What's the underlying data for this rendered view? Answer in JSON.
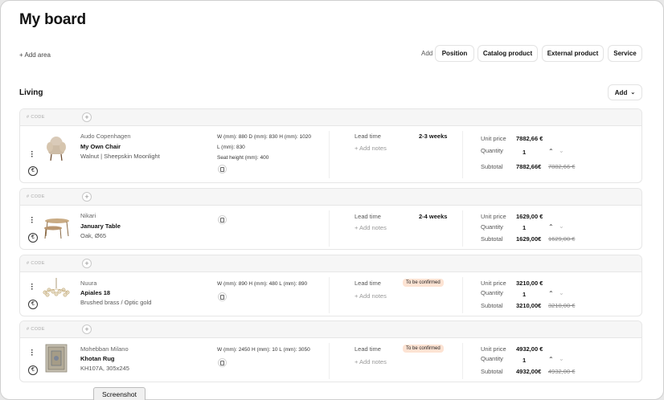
{
  "page": {
    "title": "My board",
    "add_area": "+ Add area"
  },
  "toolbar": {
    "add_label": "Add",
    "buttons": [
      "Position",
      "Catalog product",
      "External product",
      "Service"
    ]
  },
  "section": {
    "title": "Living",
    "add_button": "Add"
  },
  "items": [
    {
      "code": "# CODE",
      "brand": "Audo Copenhagen",
      "name": "My Own Chair",
      "variant": "Walnut | Sheepskin Moonlight",
      "dims_line1": "W (mm): 880   D (mm): 830   H (mm): 1020",
      "dims_line2": "L (mm): 830",
      "dims_line3": "Seat height (mm): 400",
      "lead_label": "Lead time",
      "lead_value": "2-3 weeks",
      "add_notes": "+ Add notes",
      "unit_price_label": "Unit price",
      "unit_price": "7882,66 €",
      "quantity_label": "Quantity",
      "quantity": "1",
      "subtotal_label": "Subtotal",
      "subtotal": "7882,66€",
      "subtotal_old": "7882,66 €"
    },
    {
      "code": "# CODE",
      "brand": "Nikari",
      "name": "January Table",
      "variant": "Oak, Ø65",
      "lead_label": "Lead time",
      "lead_value": "2-4 weeks",
      "add_notes": "+ Add notes",
      "unit_price_label": "Unit price",
      "unit_price": "1629,00 €",
      "quantity_label": "Quantity",
      "quantity": "1",
      "subtotal_label": "Subtotal",
      "subtotal": "1629,00€",
      "subtotal_old": "1629,00 €"
    },
    {
      "code": "# CODE",
      "brand": "Nuura",
      "name": "Apiales 18",
      "variant": "Brushed brass / Optic gold",
      "dims_line1": "W (mm): 890   H (mm): 480   L (mm): 890",
      "lead_label": "Lead time",
      "lead_badge": "To be confirmed",
      "add_notes": "+ Add notes",
      "unit_price_label": "Unit price",
      "unit_price": "3210,00 €",
      "quantity_label": "Quantity",
      "quantity": "1",
      "subtotal_label": "Subtotal",
      "subtotal": "3210,00€",
      "subtotal_old": "3210,00 €"
    },
    {
      "code": "# CODE",
      "brand": "Mohebban Milano",
      "name": "Khotan Rug",
      "variant": "KH107A, 305x245",
      "dims_line1": "W (mm): 2450   H (mm): 10   L (mm): 3050",
      "lead_label": "Lead time",
      "lead_badge": "To be confirmed",
      "add_notes": "+ Add notes",
      "unit_price_label": "Unit price",
      "unit_price": "4932,00 €",
      "quantity_label": "Quantity",
      "quantity": "1",
      "subtotal_label": "Subtotal",
      "subtotal": "4932,00€",
      "subtotal_old": "4932,00 €"
    }
  ],
  "overlay": {
    "screenshot_button": "Screenshot"
  },
  "colors": {
    "badge_bg": "#fde3d3",
    "card_header_bg": "#f6f6f6"
  }
}
